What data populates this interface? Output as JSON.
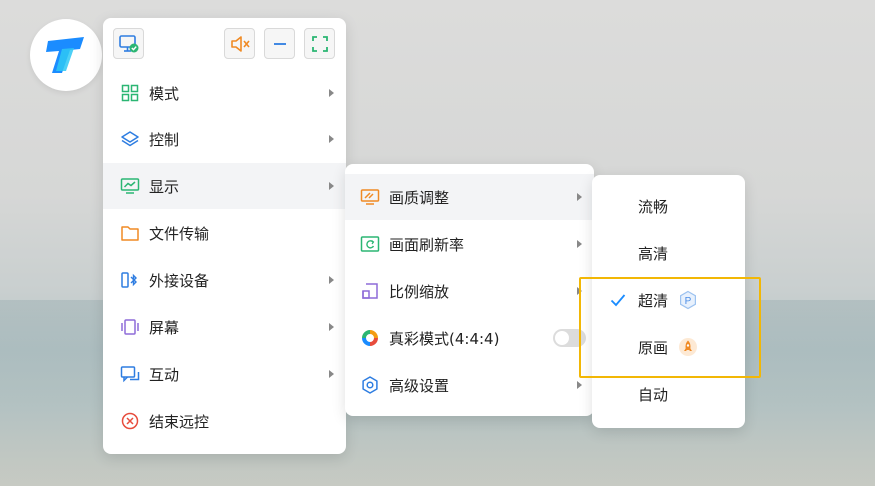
{
  "main_menu": {
    "items": [
      {
        "label": "模式",
        "has_submenu": true,
        "icon": "grid-icon"
      },
      {
        "label": "控制",
        "has_submenu": true,
        "icon": "layers-icon"
      },
      {
        "label": "显示",
        "has_submenu": true,
        "icon": "monitor-chart-icon",
        "active": true
      },
      {
        "label": "文件传输",
        "has_submenu": false,
        "icon": "folder-icon"
      },
      {
        "label": "外接设备",
        "has_submenu": true,
        "icon": "bluetooth-device-icon"
      },
      {
        "label": "屏幕",
        "has_submenu": true,
        "icon": "screen-icon"
      },
      {
        "label": "互动",
        "has_submenu": true,
        "icon": "chat-icon"
      },
      {
        "label": "结束远控",
        "has_submenu": false,
        "icon": "close-circle-icon"
      }
    ]
  },
  "display_menu": {
    "items": [
      {
        "label": "画质调整",
        "has_submenu": true,
        "icon": "picture-quality-icon",
        "active": true
      },
      {
        "label": "画面刷新率",
        "has_submenu": true,
        "icon": "refresh-screen-icon"
      },
      {
        "label": "比例缩放",
        "has_submenu": true,
        "icon": "scale-icon"
      },
      {
        "label": "真彩模式(4:4:4)",
        "has_toggle": true,
        "toggle_on": false,
        "icon": "color-wheel-icon"
      },
      {
        "label": "高级设置",
        "has_submenu": true,
        "icon": "settings-icon"
      }
    ]
  },
  "quality_menu": {
    "items": [
      {
        "label": "流畅"
      },
      {
        "label": "高清"
      },
      {
        "label": "超清",
        "checked": true,
        "badge": "P"
      },
      {
        "label": "原画",
        "badge_icon": "rocket-icon"
      },
      {
        "label": "自动"
      }
    ]
  },
  "colors": {
    "accent_blue": "#1a8cff",
    "green": "#2bb673",
    "orange": "#f39c12",
    "highlight": "#f2b705"
  }
}
